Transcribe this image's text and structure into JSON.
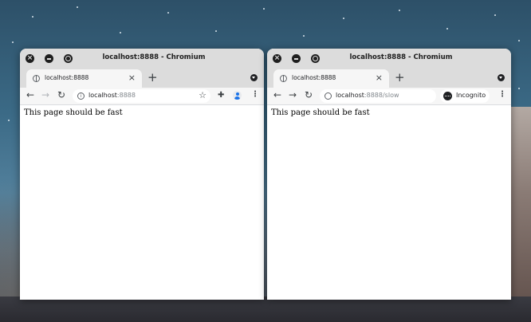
{
  "windows": [
    {
      "title": "localhost:8888 - Chromium",
      "tab": {
        "label": "localhost:8888",
        "close": "×"
      },
      "new_tab": "+",
      "url": {
        "host": "localhost",
        "rest": ":8888"
      },
      "nav": {
        "back": "←",
        "forward": "→",
        "reload": "↻"
      },
      "page_text": "This page should be fast"
    },
    {
      "title": "localhost:8888 - Chromium",
      "tab": {
        "label": "localhost:8888",
        "close": "×"
      },
      "new_tab": "+",
      "url": {
        "host": "localhost",
        "rest": ":8888/slow"
      },
      "nav": {
        "back": "←",
        "forward": "→",
        "reload": "↻"
      },
      "incognito_label": "Incognito",
      "page_text": "This page should be fast"
    }
  ],
  "icons": {
    "close": "close-icon",
    "minimize": "minimize-icon",
    "maximize": "maximize-icon",
    "favicon": "globe-icon",
    "info": "info-icon",
    "bookmark": "star-icon",
    "extensions": "puzzle-icon",
    "profile": "profile-icon",
    "menu": "kebab-menu-icon",
    "tab_search": "tab-search-icon",
    "incognito": "incognito-icon"
  },
  "colors": {
    "titlebar": "#dcdcdc",
    "tab_active": "#f6f6f6",
    "toolbar": "#f6f6f6",
    "page": "#ffffff"
  }
}
